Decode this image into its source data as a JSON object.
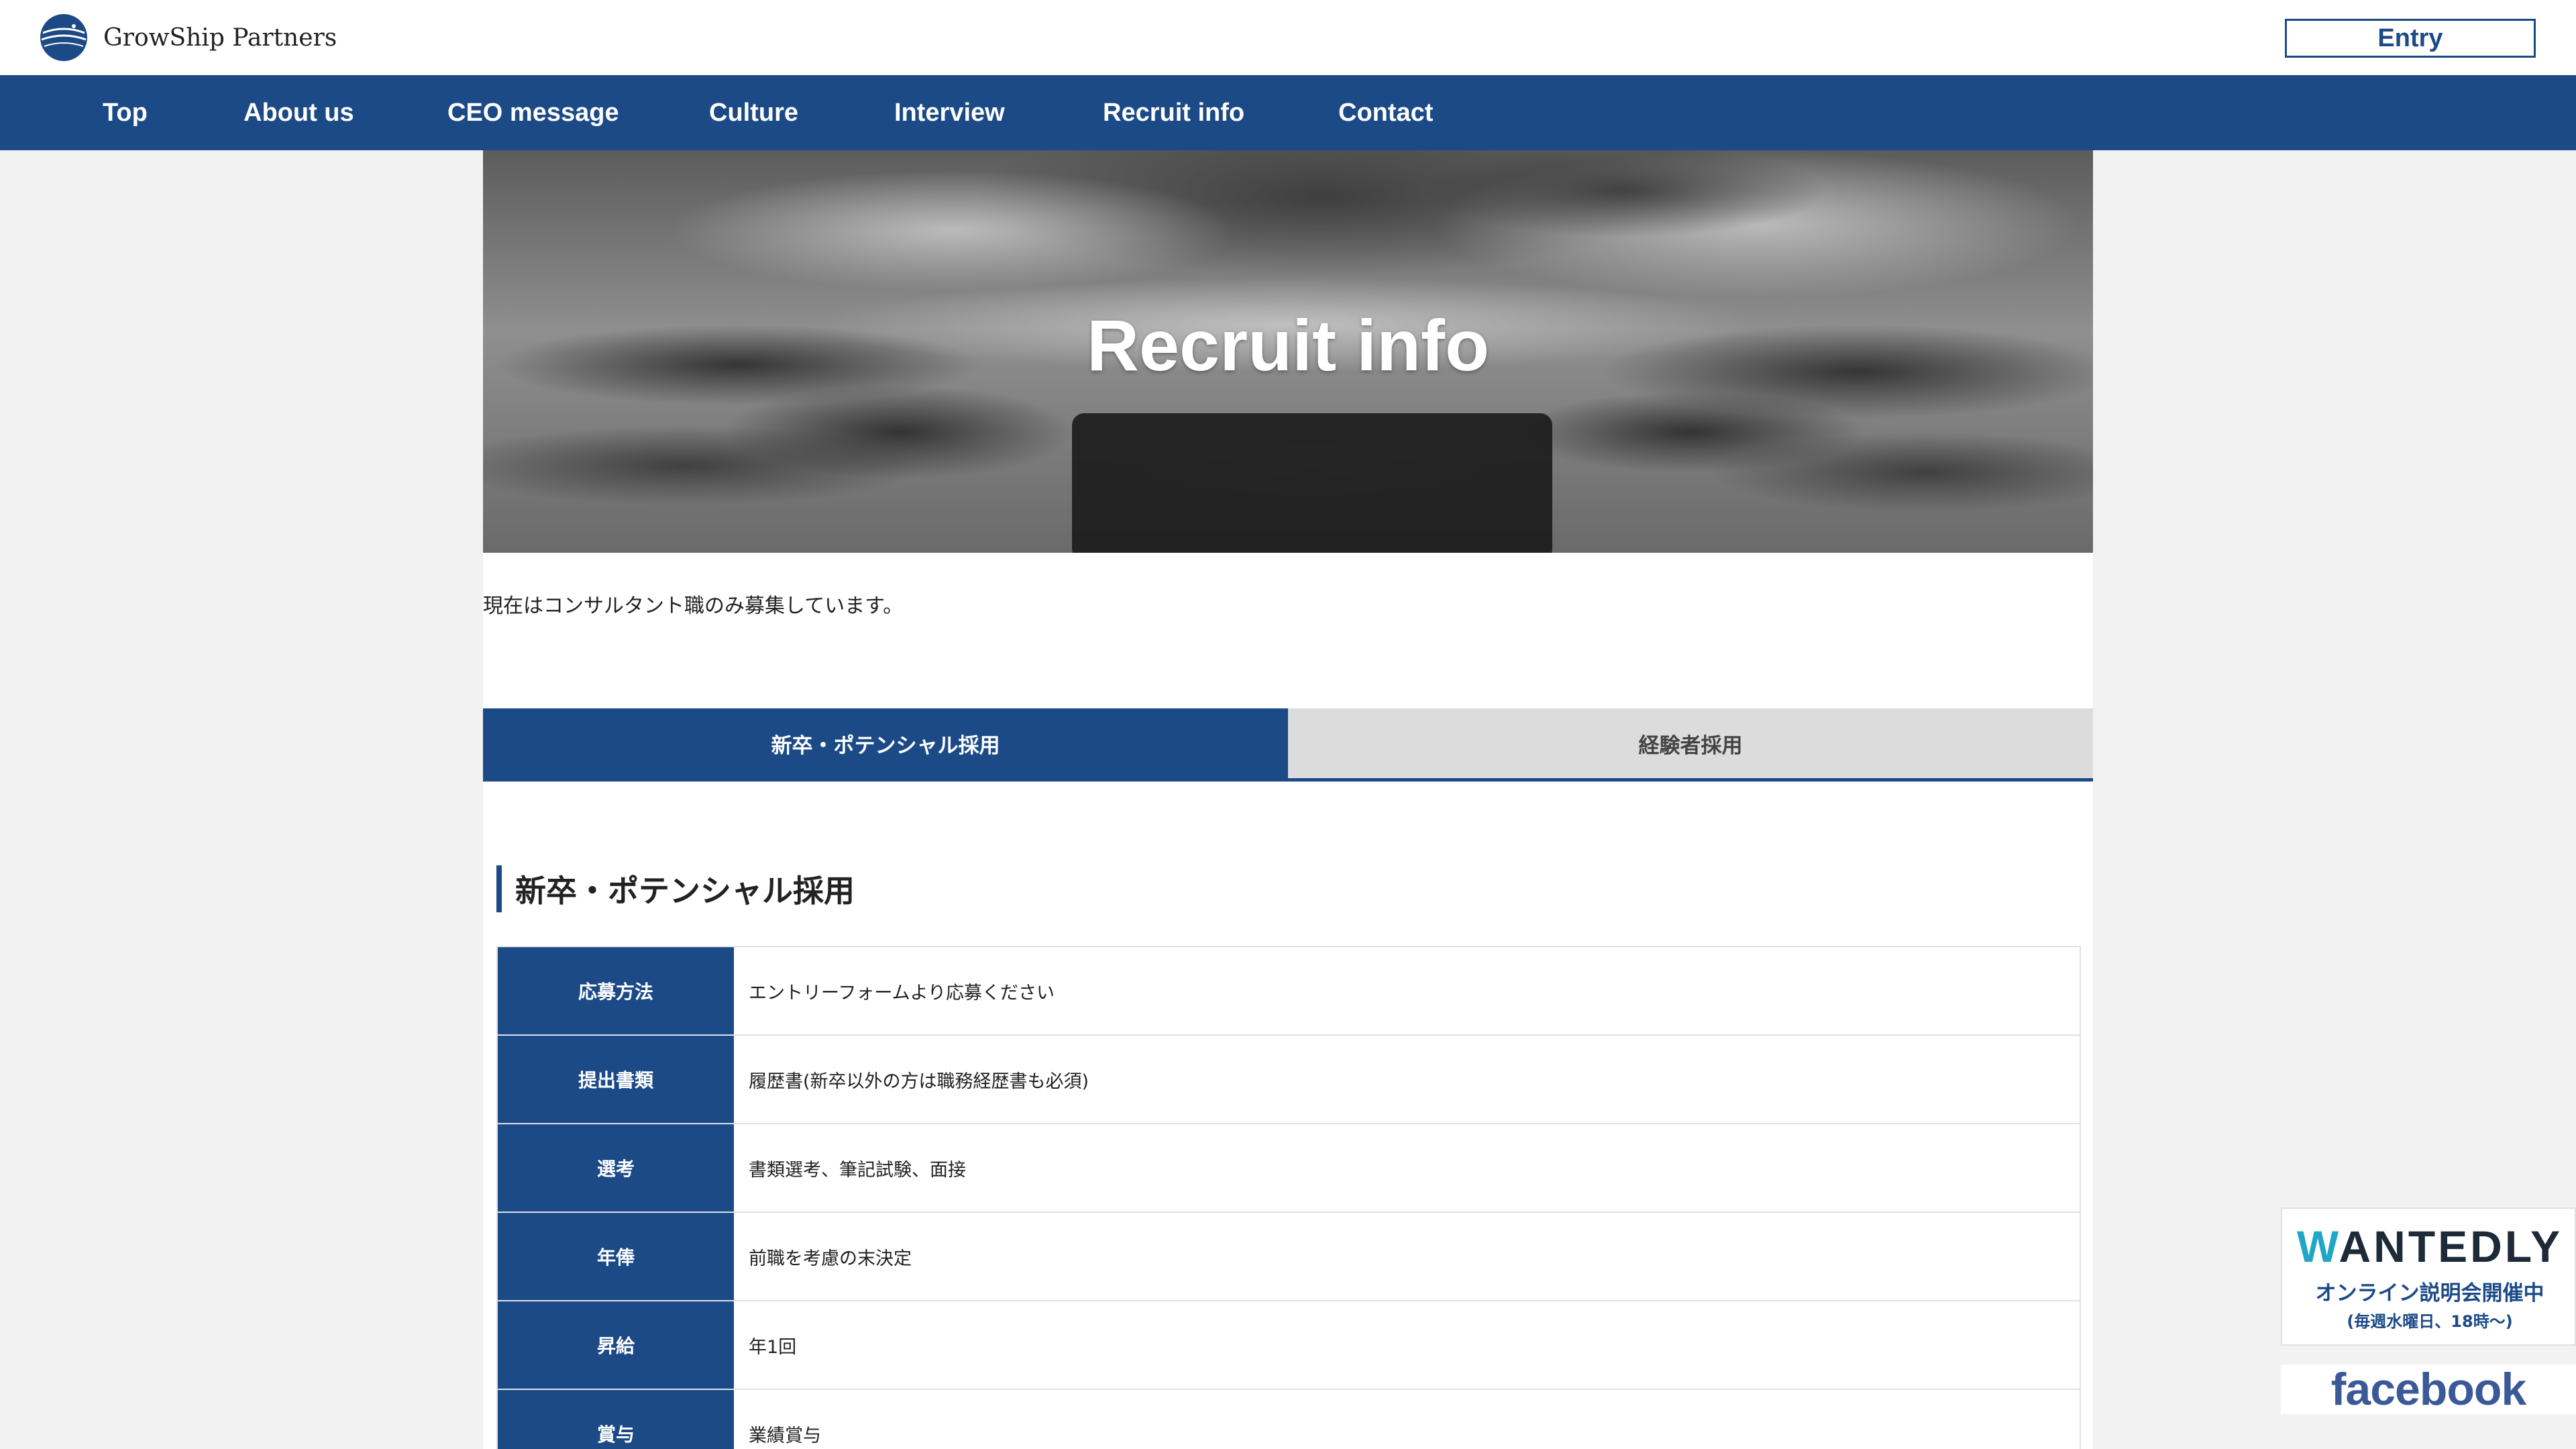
{
  "header": {
    "brand": "GrowShip Partners",
    "entry_label": "Entry",
    "accent_color": "#1b4a87"
  },
  "nav": {
    "items": [
      {
        "label": "Top"
      },
      {
        "label": "About us"
      },
      {
        "label": "CEO message"
      },
      {
        "label": "Culture"
      },
      {
        "label": "Interview"
      },
      {
        "label": "Recruit info"
      },
      {
        "label": "Contact"
      }
    ]
  },
  "hero": {
    "title": "Recruit info"
  },
  "intro": "現在はコンサルタント職のみ募集しています。",
  "tabs": [
    {
      "label": "新卒・ポテンシャル採用",
      "active": true
    },
    {
      "label": "経験者採用",
      "active": false
    }
  ],
  "section": {
    "heading": "新卒・ポテンシャル採用",
    "rows": [
      {
        "label": "応募方法",
        "value": "エントリーフォームより応募ください"
      },
      {
        "label": "提出書類",
        "value": "履歴書(新卒以外の方は職務経歴書も必須)"
      },
      {
        "label": "選考",
        "value": "書類選考、筆記試験、面接"
      },
      {
        "label": "年俸",
        "value": "前職を考慮の末決定"
      },
      {
        "label": "昇給",
        "value": "年1回"
      },
      {
        "label": "賞与",
        "value": "業績賞与"
      }
    ]
  },
  "banners": {
    "wantedly": {
      "logo_first": "W",
      "logo_rest": "ANTEDLY",
      "line1": "オンライン説明会開催中",
      "line2": "(毎週水曜日、18時〜)"
    },
    "facebook": {
      "label": "facebook"
    }
  },
  "icons": {
    "logo": "globe-ship-logo-icon"
  }
}
